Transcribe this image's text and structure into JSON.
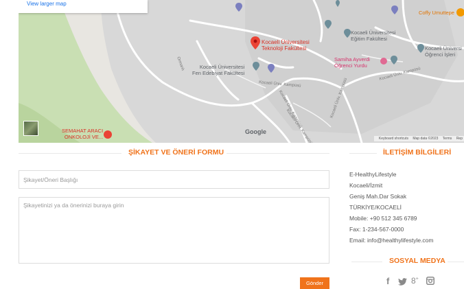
{
  "map": {
    "larger_map_link": "View larger map",
    "places": {
      "main": "Kocaeli Üniversitesi\nTeknoloji Fakültesi",
      "egitim": "Kocaeli Üniversitesi\nEğitim Fakültesi",
      "ogrenci": "Kocaeli Üniversi\nÖğrenci İşleri",
      "yurt": "Samiha Ayverdi\nÖğrenci Yurdu",
      "edebiyat": "Kocaeli Üniversitesi\nFen Edebiyat Fakültesi",
      "hastane": "SEMAHAT ARACI\nONKOLOJİ VE...",
      "coffy": "Coffy Umuttepe"
    },
    "roads": [
      "Kocaeli Üniv. Kampüsü",
      "Kocaeli Üniv. Kampüsü",
      "Kocaeli Üniv. Kampüsü",
      "Ormanlı",
      "Kocaeli Üniv. Kampüsü",
      "Kocaeli Üniv. Kampüsü"
    ],
    "google": "Google",
    "footer": {
      "shortcuts": "Keyboard shortcuts",
      "data": "Map data ©2023",
      "terms": "Terms",
      "report": "Rep"
    }
  },
  "form": {
    "title": "ŞİKAYET VE ÖNERİ FORMU",
    "subject_placeholder": "Şikayet/Öneri Başlığı",
    "message_placeholder": "Şikayetinizi ya da önerinizi buraya girin",
    "send_label": "Gönder"
  },
  "contact": {
    "title": "İLETİŞİM BİLGİLERİ",
    "lines": [
      "E-HealthyLifestyle",
      "Kocaeli/İzmit",
      "Geniş Mah.Dar Sokak",
      "TÜRKİYE/KOCAELİ",
      "Mobile: +90 512 345 6789",
      "Fax: 1-234-567-0000",
      "Email: info@healthylifestyle.com"
    ]
  },
  "social": {
    "title": "SOSYAL MEDYA",
    "icons": [
      "facebook-icon",
      "twitter-icon",
      "google-plus-icon",
      "instagram-icon"
    ]
  },
  "colors": {
    "accent": "#f0731b",
    "map_bg": "#e5e3df",
    "campus": "#d6d6d6",
    "park": "#c8dfb4",
    "marker": "#ea4335"
  }
}
